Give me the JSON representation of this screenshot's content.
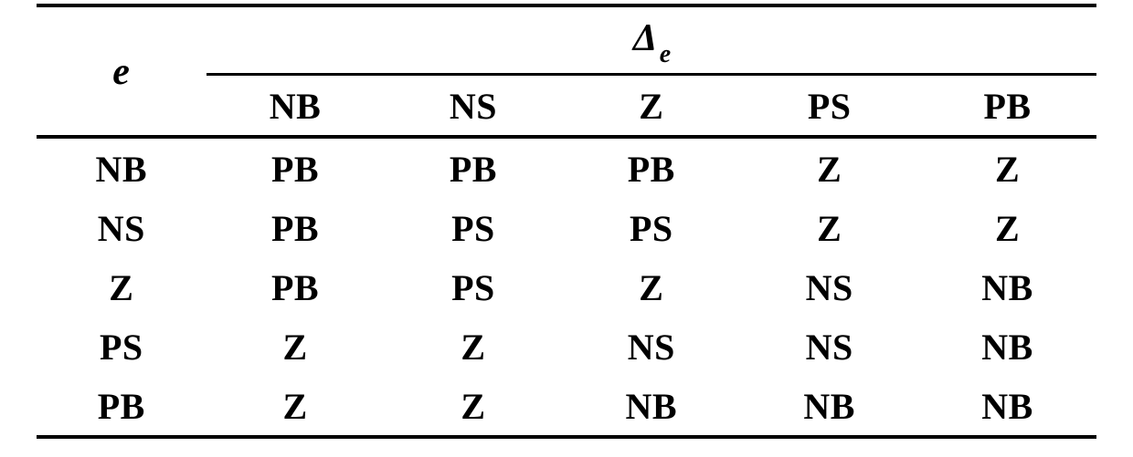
{
  "chart_data": {
    "type": "table",
    "title": "",
    "row_variable": "e",
    "column_variable": "Δe",
    "column_headers": [
      "NB",
      "NS",
      "Z",
      "PS",
      "PB"
    ],
    "row_headers": [
      "NB",
      "NS",
      "Z",
      "PS",
      "PB"
    ],
    "values": [
      [
        "PB",
        "PB",
        "PB",
        "Z",
        "Z"
      ],
      [
        "PB",
        "PS",
        "PS",
        "Z",
        "Z"
      ],
      [
        "PB",
        "PS",
        "Z",
        "NS",
        "NB"
      ],
      [
        "Z",
        "Z",
        "NS",
        "NS",
        "NB"
      ],
      [
        "Z",
        "Z",
        "NB",
        "NB",
        "NB"
      ]
    ]
  },
  "labels": {
    "row_var_html": "e",
    "col_var_main": "Δ",
    "col_var_sub": "e"
  }
}
